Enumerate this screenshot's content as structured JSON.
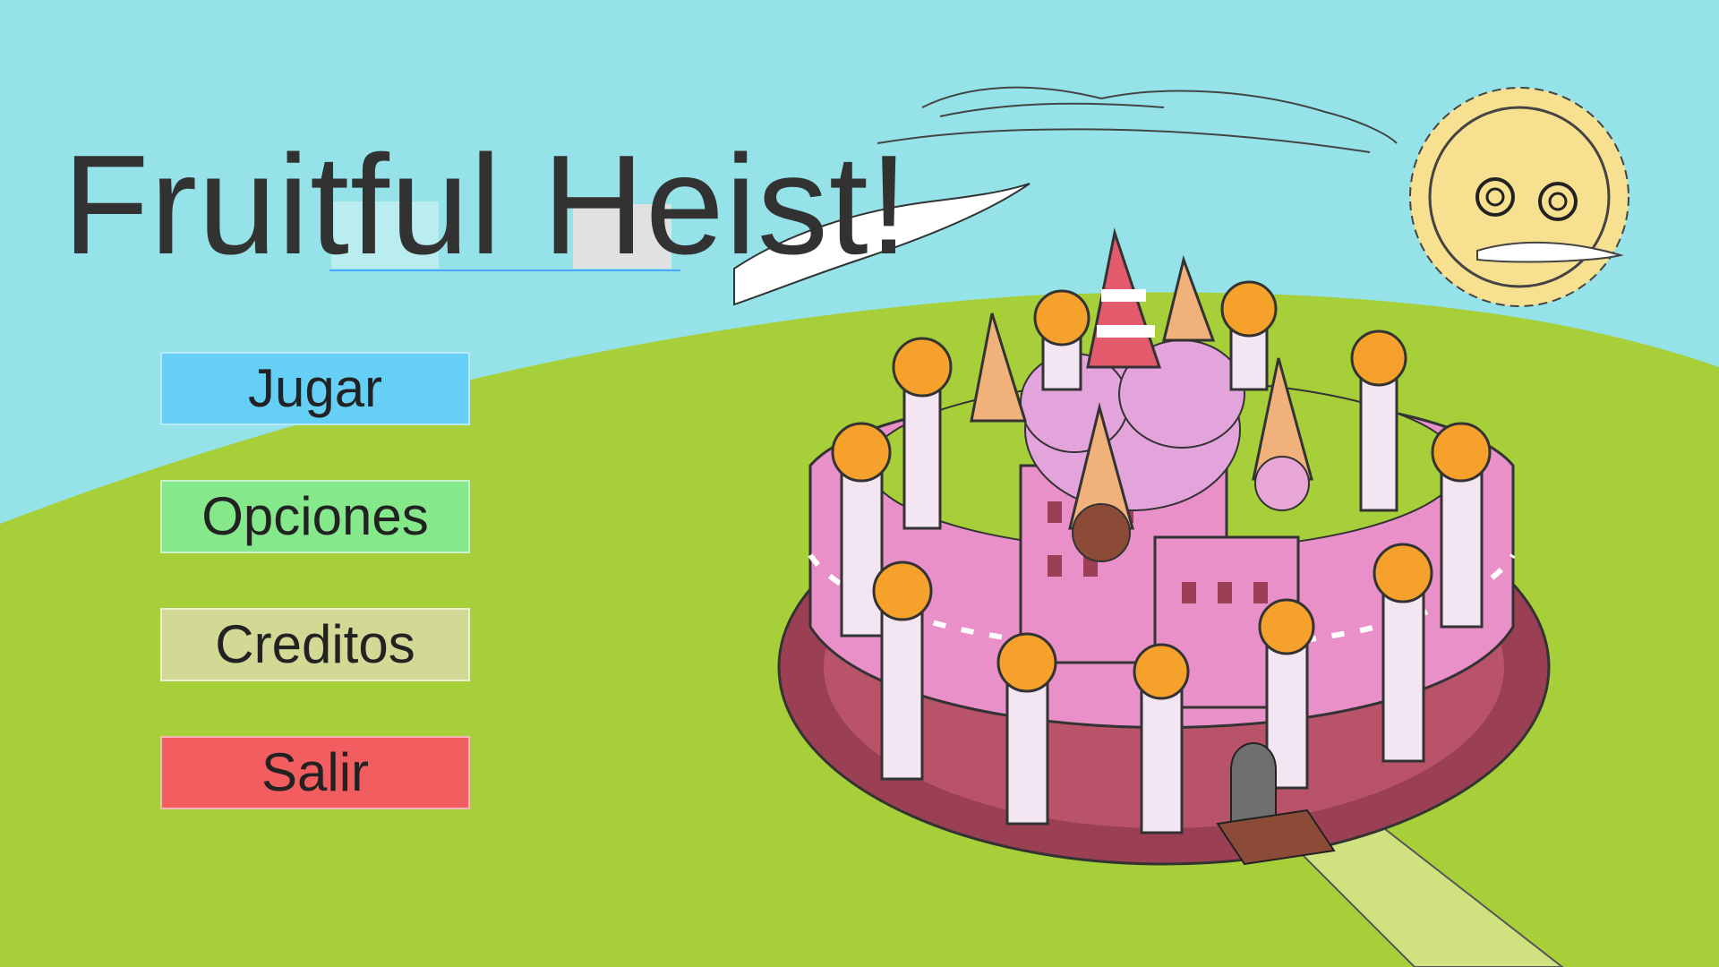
{
  "title": "Fruitful Heist!",
  "menu": {
    "play_label": "Jugar",
    "options_label": "Opciones",
    "credits_label": "Creditos",
    "exit_label": "Salir"
  },
  "colors": {
    "sky": "#95e3e9",
    "grass": "#a6cf3a",
    "play_button": "#66cff5",
    "options_button": "#85e88a",
    "credits_button": "#d2d994",
    "exit_button": "#f25d60",
    "castle_pink": "#e990c9",
    "moat": "#9b3f55",
    "sun": "#f7e08f"
  }
}
